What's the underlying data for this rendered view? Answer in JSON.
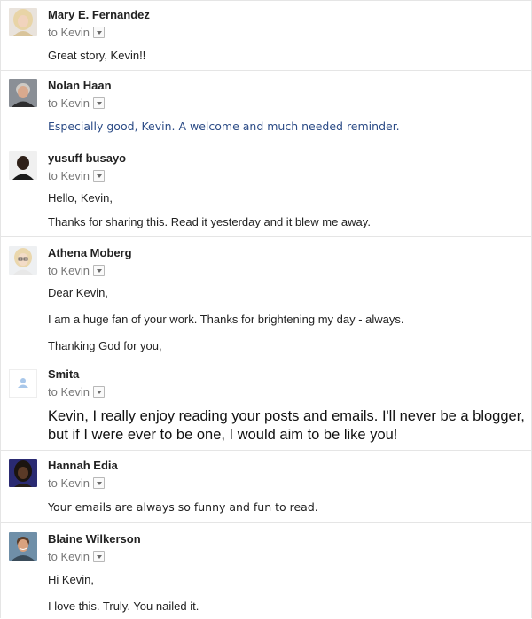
{
  "messages": [
    {
      "sender": "Mary E. Fernandez",
      "to": "to Kevin",
      "avatar": "blonde-woman-avatar",
      "lines": [
        "Great story, Kevin!!"
      ]
    },
    {
      "sender": "Nolan Haan",
      "to": "to Kevin",
      "avatar": "older-man-avatar",
      "lines": [
        "Especially good, Kevin. A welcome and much needed reminder."
      ]
    },
    {
      "sender": "yusuff busayo",
      "to": "to Kevin",
      "avatar": "man-avatar",
      "lines": [
        "Hello, Kevin,",
        "Thanks for sharing this. Read it yesterday and it blew me away."
      ]
    },
    {
      "sender": "Athena Moberg",
      "to": "to Kevin",
      "avatar": "woman-glasses-avatar",
      "lines": [
        "Dear Kevin,",
        "I am a huge fan of your work. Thanks for brightening my day - always.",
        "Thanking God for you,"
      ]
    },
    {
      "sender": "Smita",
      "to": "to Kevin",
      "avatar": "default-person-avatar",
      "lines": [
        "Kevin, I really enjoy reading your posts and emails. I'll never be a blogger,",
        "but if I were ever to be one, I would aim to be like you!"
      ]
    },
    {
      "sender": "Hannah Edia",
      "to": "to Kevin",
      "avatar": "woman-avatar",
      "lines": [
        "Your emails are always so funny and fun to read."
      ]
    },
    {
      "sender": "Blaine Wilkerson",
      "to": "to Kevin",
      "avatar": "smiling-man-avatar",
      "lines": [
        "Hi Kevin,",
        "I love this. Truly. You nailed it."
      ]
    }
  ],
  "colors": {
    "sender": "#222222",
    "recipient": "#777777",
    "body_text": "#222222",
    "blue_text": "#2b4b86",
    "divider": "#e5e5e5"
  }
}
